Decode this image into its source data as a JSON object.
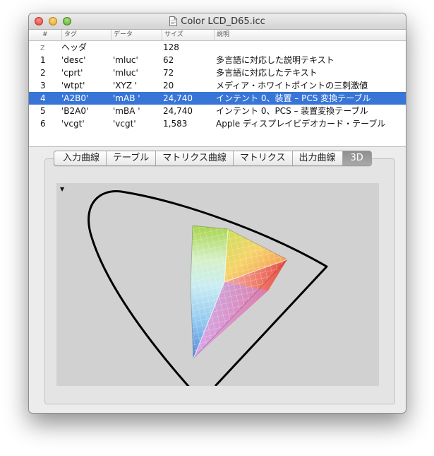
{
  "window": {
    "title": "Color LCD_D65.icc",
    "close_icon": "close-icon",
    "minimize_icon": "minimize-icon",
    "zoom_icon": "zoom-icon",
    "title_icon": "document-icon"
  },
  "table": {
    "columns": [
      "#",
      "タグ",
      "データ",
      "サイズ",
      "説明"
    ],
    "rows": [
      {
        "num": "z",
        "tag": "ヘッダ",
        "data": "",
        "size": "128",
        "desc": ""
      },
      {
        "num": "1",
        "tag": "'desc'",
        "data": "'mluc'",
        "size": "62",
        "desc": "多言語に対応した説明テキスト"
      },
      {
        "num": "2",
        "tag": "'cprt'",
        "data": "'mluc'",
        "size": "72",
        "desc": "多言語に対応したテキスト"
      },
      {
        "num": "3",
        "tag": "'wtpt'",
        "data": "'XYZ '",
        "size": "20",
        "desc": "メディア・ホワイトポイントの三刺激値"
      },
      {
        "num": "4",
        "tag": "'A2B0'",
        "data": "'mAB '",
        "size": "24,740",
        "desc": "インテント 0、装置 – PCS 変換テーブル",
        "selected": true
      },
      {
        "num": "5",
        "tag": "'B2A0'",
        "data": "'mBA '",
        "size": "24,740",
        "desc": "インテント 0、PCS – 装置変換テーブル"
      },
      {
        "num": "6",
        "tag": "'vcgt'",
        "data": "'vcgt'",
        "size": "1,583",
        "desc": "Apple ディスプレイビデオカード・テーブル"
      }
    ]
  },
  "tabs": [
    "入力曲線",
    "テーブル",
    "マトリクス曲線",
    "マトリクス",
    "出力曲線",
    "3D"
  ],
  "active_tab": "3D",
  "colors": {
    "selection": "#3875d7",
    "plot_background": "#d1d1d1",
    "locus_stroke": "#000000"
  },
  "view3d": {
    "disclosure_icon": "disclosure-triangle-icon",
    "diagram": "gamut-3d-view"
  }
}
